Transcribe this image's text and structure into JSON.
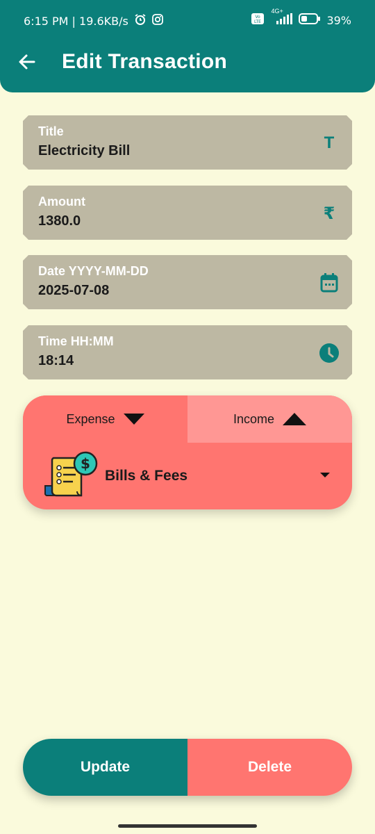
{
  "status_bar": {
    "time_speed": "6:15 PM | 19.6KB/s",
    "network": "4G+",
    "battery": "39%"
  },
  "header": {
    "title": "Edit Transaction"
  },
  "fields": {
    "title": {
      "label": "Title",
      "value": "Electricity Bill",
      "icon": "T"
    },
    "amount": {
      "label": "Amount",
      "value": "1380.0",
      "icon": "₹"
    },
    "date": {
      "label": "Date YYYY-MM-DD",
      "value": "2025-07-08"
    },
    "time": {
      "label": "Time  HH:MM",
      "value": "18:14"
    }
  },
  "type_tabs": {
    "expense": "Expense",
    "income": "Income",
    "selected": "Expense"
  },
  "category": {
    "name": "Bills & Fees"
  },
  "actions": {
    "update": "Update",
    "delete": "Delete"
  },
  "colors": {
    "primary": "#0b7f7a",
    "accent": "#ff7570",
    "accent_light": "#ff9794",
    "field_bg": "#bdb8a3",
    "page_bg": "#fafadc"
  }
}
